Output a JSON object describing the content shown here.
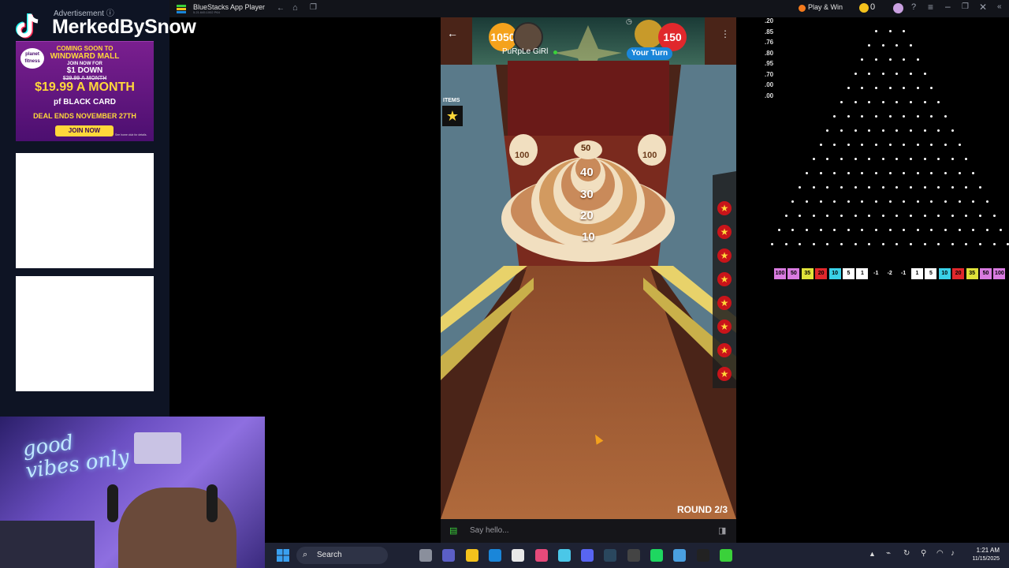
{
  "stream": {
    "ad_label": "Advertisement ⓘ",
    "streamer_name": "MerkedBySnow"
  },
  "ad": {
    "logo_text": "planet fitness",
    "line1": "COMING SOON TO",
    "line2": "WINDWARD MALL",
    "line3": "JOIN NOW FOR",
    "line4": "$1 DOWN",
    "line5": "$29.99 A MONTH",
    "line6": "$19.99 A MONTH",
    "line7": "pf BLACK CARD",
    "line8": "DEAL ENDS NOVEMBER 27TH",
    "join_button": "JOIN NOW",
    "fine_print": "See home club for details."
  },
  "webcam": {
    "neon_text": "good vibes only"
  },
  "bluestacks": {
    "app_title": "BlueStacks App Player",
    "app_version": "5.21.645.1002  P64",
    "play_win_label": "Play & Win",
    "coin_count": "0",
    "colors": {
      "titlebar": "#12141a",
      "accent": "#f4a21c"
    }
  },
  "game": {
    "player1": {
      "score": "1050",
      "name": "PuRpLe GiRl"
    },
    "player2": {
      "score": "150",
      "status": "Your Turn"
    },
    "items_label": "ITEMS",
    "targets": {
      "left": "100",
      "right": "100",
      "top": "50",
      "rings": [
        "40",
        "30",
        "20",
        "10"
      ]
    },
    "round_label": "ROUND 2/3",
    "chat_placeholder": "Say hello...",
    "powerup_count": 8
  },
  "plinko": {
    "multipliers": [
      ".20",
      ".85",
      ".76",
      ".80",
      ".95",
      ".70",
      ".00",
      ".00"
    ],
    "slots": [
      {
        "label": "100",
        "color": "#d97be0"
      },
      {
        "label": "50",
        "color": "#d97be0"
      },
      {
        "label": "35",
        "color": "#e0e23a"
      },
      {
        "label": "20",
        "color": "#e0282c"
      },
      {
        "label": "10",
        "color": "#3ad1e8"
      },
      {
        "label": "5",
        "color": "#ffffff"
      },
      {
        "label": "1",
        "color": "#ffffff"
      },
      {
        "label": "-1",
        "color": "#000000"
      },
      {
        "label": "-2",
        "color": "#000000"
      },
      {
        "label": "-1",
        "color": "#000000"
      },
      {
        "label": "1",
        "color": "#ffffff"
      },
      {
        "label": "5",
        "color": "#ffffff"
      },
      {
        "label": "10",
        "color": "#3ad1e8"
      },
      {
        "label": "20",
        "color": "#e0282c"
      },
      {
        "label": "35",
        "color": "#e0e23a"
      },
      {
        "label": "50",
        "color": "#d97be0"
      },
      {
        "label": "100",
        "color": "#d97be0"
      }
    ]
  },
  "taskbar": {
    "search_label": "Search",
    "time": "1:21 AM",
    "date": "11/15/2025",
    "pinned_icons": [
      "file-explorer-icon",
      "teams-icon",
      "folder-icon",
      "edge-icon",
      "store-icon",
      "pinterest-icon",
      "copilot-icon",
      "discord-icon",
      "steam-icon",
      "obs-icon",
      "spotify-icon",
      "notepad-icon",
      "epic-games-icon",
      "bluestacks-icon"
    ]
  }
}
